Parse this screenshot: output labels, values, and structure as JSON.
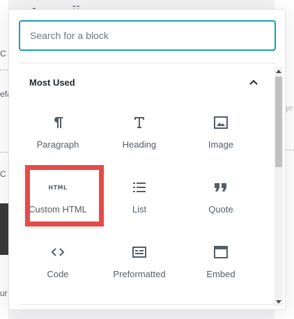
{
  "search": {
    "placeholder": "Search for a block"
  },
  "panel": {
    "title": "Most Used"
  },
  "blocks": [
    {
      "label": "Paragraph",
      "icon": "paragraph-icon"
    },
    {
      "label": "Heading",
      "icon": "heading-icon"
    },
    {
      "label": "Image",
      "icon": "image-icon"
    },
    {
      "label": "Custom HTML",
      "icon": "html-icon",
      "icon_text": "HTML"
    },
    {
      "label": "List",
      "icon": "list-icon"
    },
    {
      "label": "Quote",
      "icon": "quote-icon"
    },
    {
      "label": "Code",
      "icon": "code-icon"
    },
    {
      "label": "Preformatted",
      "icon": "preformatted-icon"
    },
    {
      "label": "Embed",
      "icon": "embed-icon"
    }
  ],
  "background": {
    "frag_top": "C",
    "frag_mid": "efa",
    "frag_c": "C",
    "frag_bottom": "ur",
    "frag_right": "ge"
  },
  "colors": {
    "accent": "#1a9eb0",
    "highlight": "#e54a4a",
    "text": "#555d66"
  }
}
